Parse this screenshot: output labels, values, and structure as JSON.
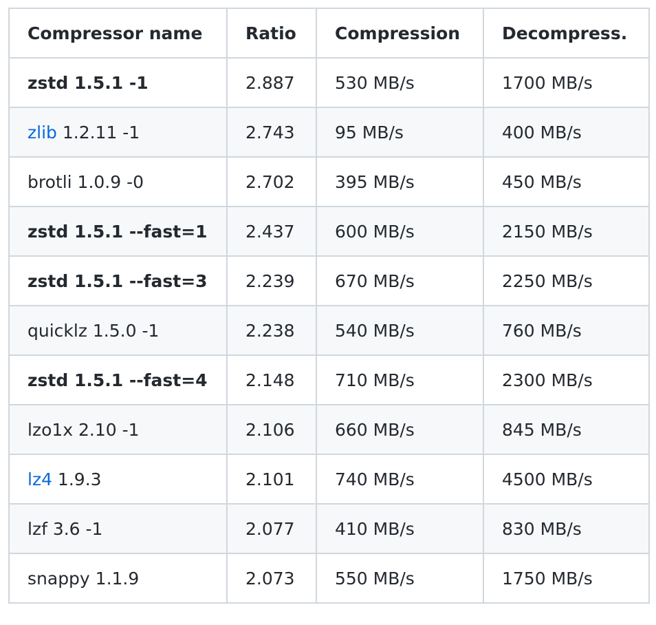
{
  "table": {
    "headers": [
      "Compressor name",
      "Ratio",
      "Compression",
      "Decompress."
    ],
    "rows": [
      {
        "link": "",
        "name": "zstd 1.5.1 -1",
        "bold": true,
        "ratio": "2.887",
        "compression": "530 MB/s",
        "decompression": "1700 MB/s"
      },
      {
        "link": "zlib",
        "name": " 1.2.11 -1",
        "bold": false,
        "ratio": "2.743",
        "compression": "95 MB/s",
        "decompression": "400 MB/s"
      },
      {
        "link": "",
        "name": "brotli 1.0.9 -0",
        "bold": false,
        "ratio": "2.702",
        "compression": "395 MB/s",
        "decompression": "450 MB/s"
      },
      {
        "link": "",
        "name": "zstd 1.5.1 --fast=1",
        "bold": true,
        "ratio": "2.437",
        "compression": "600 MB/s",
        "decompression": "2150 MB/s"
      },
      {
        "link": "",
        "name": "zstd 1.5.1 --fast=3",
        "bold": true,
        "ratio": "2.239",
        "compression": "670 MB/s",
        "decompression": "2250 MB/s"
      },
      {
        "link": "",
        "name": "quicklz 1.5.0 -1",
        "bold": false,
        "ratio": "2.238",
        "compression": "540 MB/s",
        "decompression": "760 MB/s"
      },
      {
        "link": "",
        "name": "zstd 1.5.1 --fast=4",
        "bold": true,
        "ratio": "2.148",
        "compression": "710 MB/s",
        "decompression": "2300 MB/s"
      },
      {
        "link": "",
        "name": "lzo1x 2.10 -1",
        "bold": false,
        "ratio": "2.106",
        "compression": "660 MB/s",
        "decompression": "845 MB/s"
      },
      {
        "link": "lz4",
        "name": " 1.9.3",
        "bold": false,
        "ratio": "2.101",
        "compression": "740 MB/s",
        "decompression": "4500 MB/s"
      },
      {
        "link": "",
        "name": "lzf 3.6 -1",
        "bold": false,
        "ratio": "2.077",
        "compression": "410 MB/s",
        "decompression": "830 MB/s"
      },
      {
        "link": "",
        "name": "snappy 1.1.9",
        "bold": false,
        "ratio": "2.073",
        "compression": "550 MB/s",
        "decompression": "1750 MB/s"
      }
    ]
  },
  "colors": {
    "link": "#0969da",
    "border": "#d0d7de",
    "stripe": "#f6f8fa",
    "text": "#24292f"
  }
}
